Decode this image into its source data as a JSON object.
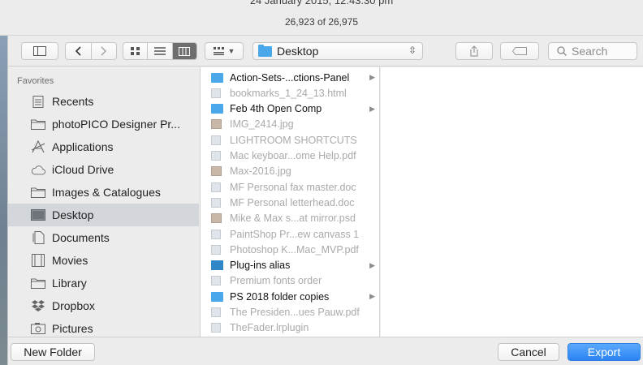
{
  "header": {
    "line1": "24 January 2015, 12:43:30 pm",
    "line2": "26,923 of 26,975"
  },
  "toolbar": {
    "location": "Desktop",
    "search_placeholder": "Search"
  },
  "sidebar": {
    "heading": "Favorites",
    "items": [
      {
        "label": "Recents",
        "icon": "recents-icon"
      },
      {
        "label": "photoPICO Designer Pr...",
        "icon": "folder-icon"
      },
      {
        "label": "Applications",
        "icon": "applications-icon"
      },
      {
        "label": "iCloud Drive",
        "icon": "cloud-icon"
      },
      {
        "label": "Images & Catalogues",
        "icon": "folder-icon"
      },
      {
        "label": "Desktop",
        "icon": "desktop-icon",
        "selected": true
      },
      {
        "label": "Documents",
        "icon": "documents-icon"
      },
      {
        "label": "Movies",
        "icon": "movies-icon"
      },
      {
        "label": "Library",
        "icon": "folder-icon"
      },
      {
        "label": "Dropbox",
        "icon": "dropbox-icon"
      },
      {
        "label": "Pictures",
        "icon": "pictures-icon"
      }
    ]
  },
  "files": [
    {
      "name": "Action-Sets-...ctions-Panel",
      "kind": "folder",
      "enabled": true
    },
    {
      "name": "bookmarks_1_24_13.html",
      "kind": "doc",
      "enabled": false
    },
    {
      "name": "Feb 4th Open Comp",
      "kind": "folder",
      "enabled": true
    },
    {
      "name": "IMG_2414.jpg",
      "kind": "img",
      "enabled": false
    },
    {
      "name": "LIGHTROOM SHORTCUTS",
      "kind": "doc",
      "enabled": false
    },
    {
      "name": "Mac keyboar...ome Help.pdf",
      "kind": "doc",
      "enabled": false
    },
    {
      "name": "Max-2016.jpg",
      "kind": "img",
      "enabled": false
    },
    {
      "name": "MF Personal fax master.doc",
      "kind": "doc",
      "enabled": false
    },
    {
      "name": "MF Personal letterhead.doc",
      "kind": "doc",
      "enabled": false
    },
    {
      "name": "Mike & Max s...at mirror.psd",
      "kind": "img",
      "enabled": false
    },
    {
      "name": "PaintShop Pr...ew canvass 1",
      "kind": "doc",
      "enabled": false
    },
    {
      "name": "Photoshop K...Mac_MVP.pdf",
      "kind": "doc",
      "enabled": false
    },
    {
      "name": "Plug-ins alias",
      "kind": "alias",
      "enabled": true
    },
    {
      "name": "Premium fonts order",
      "kind": "doc",
      "enabled": false
    },
    {
      "name": "PS 2018 folder copies",
      "kind": "folder",
      "enabled": true
    },
    {
      "name": "The Presiden...ues Pauw.pdf",
      "kind": "doc",
      "enabled": false
    },
    {
      "name": "TheFader.lrplugin",
      "kind": "doc",
      "enabled": false
    }
  ],
  "buttons": {
    "new_folder": "New Folder",
    "cancel": "Cancel",
    "export": "Export"
  },
  "colors": {
    "accent": "#2b84f3",
    "folder": "#4aa8ea",
    "selection": "#d3d6db"
  }
}
